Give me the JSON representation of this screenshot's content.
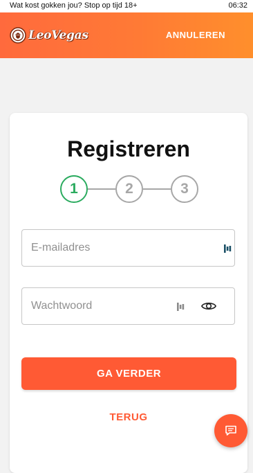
{
  "status_bar": {
    "message": "Wat kost gokken jou? Stop op tijd 18+",
    "time": "06:32"
  },
  "header": {
    "logo_text": "LeoVegas",
    "cancel_label": "ANNULEREN"
  },
  "form": {
    "title": "Registreren",
    "steps": [
      "1",
      "2",
      "3"
    ],
    "active_step": 1,
    "email": {
      "value": "",
      "placeholder": "E-mailadres"
    },
    "password": {
      "value": "",
      "placeholder": "Wachtwoord"
    },
    "continue_label": "GA VERDER",
    "back_label": "TERUG"
  },
  "colors": {
    "brand_orange": "#ff5a34",
    "header_gradient_start": "#ff6a3d",
    "header_gradient_end": "#ff8f2c",
    "active_step": "#2bab5f",
    "inactive_step": "#a7a7a7"
  },
  "icons": {
    "logo": "lion-head-icon",
    "password_manager": "keeper-icon",
    "show_password": "eye-icon",
    "chat": "chat-icon"
  }
}
